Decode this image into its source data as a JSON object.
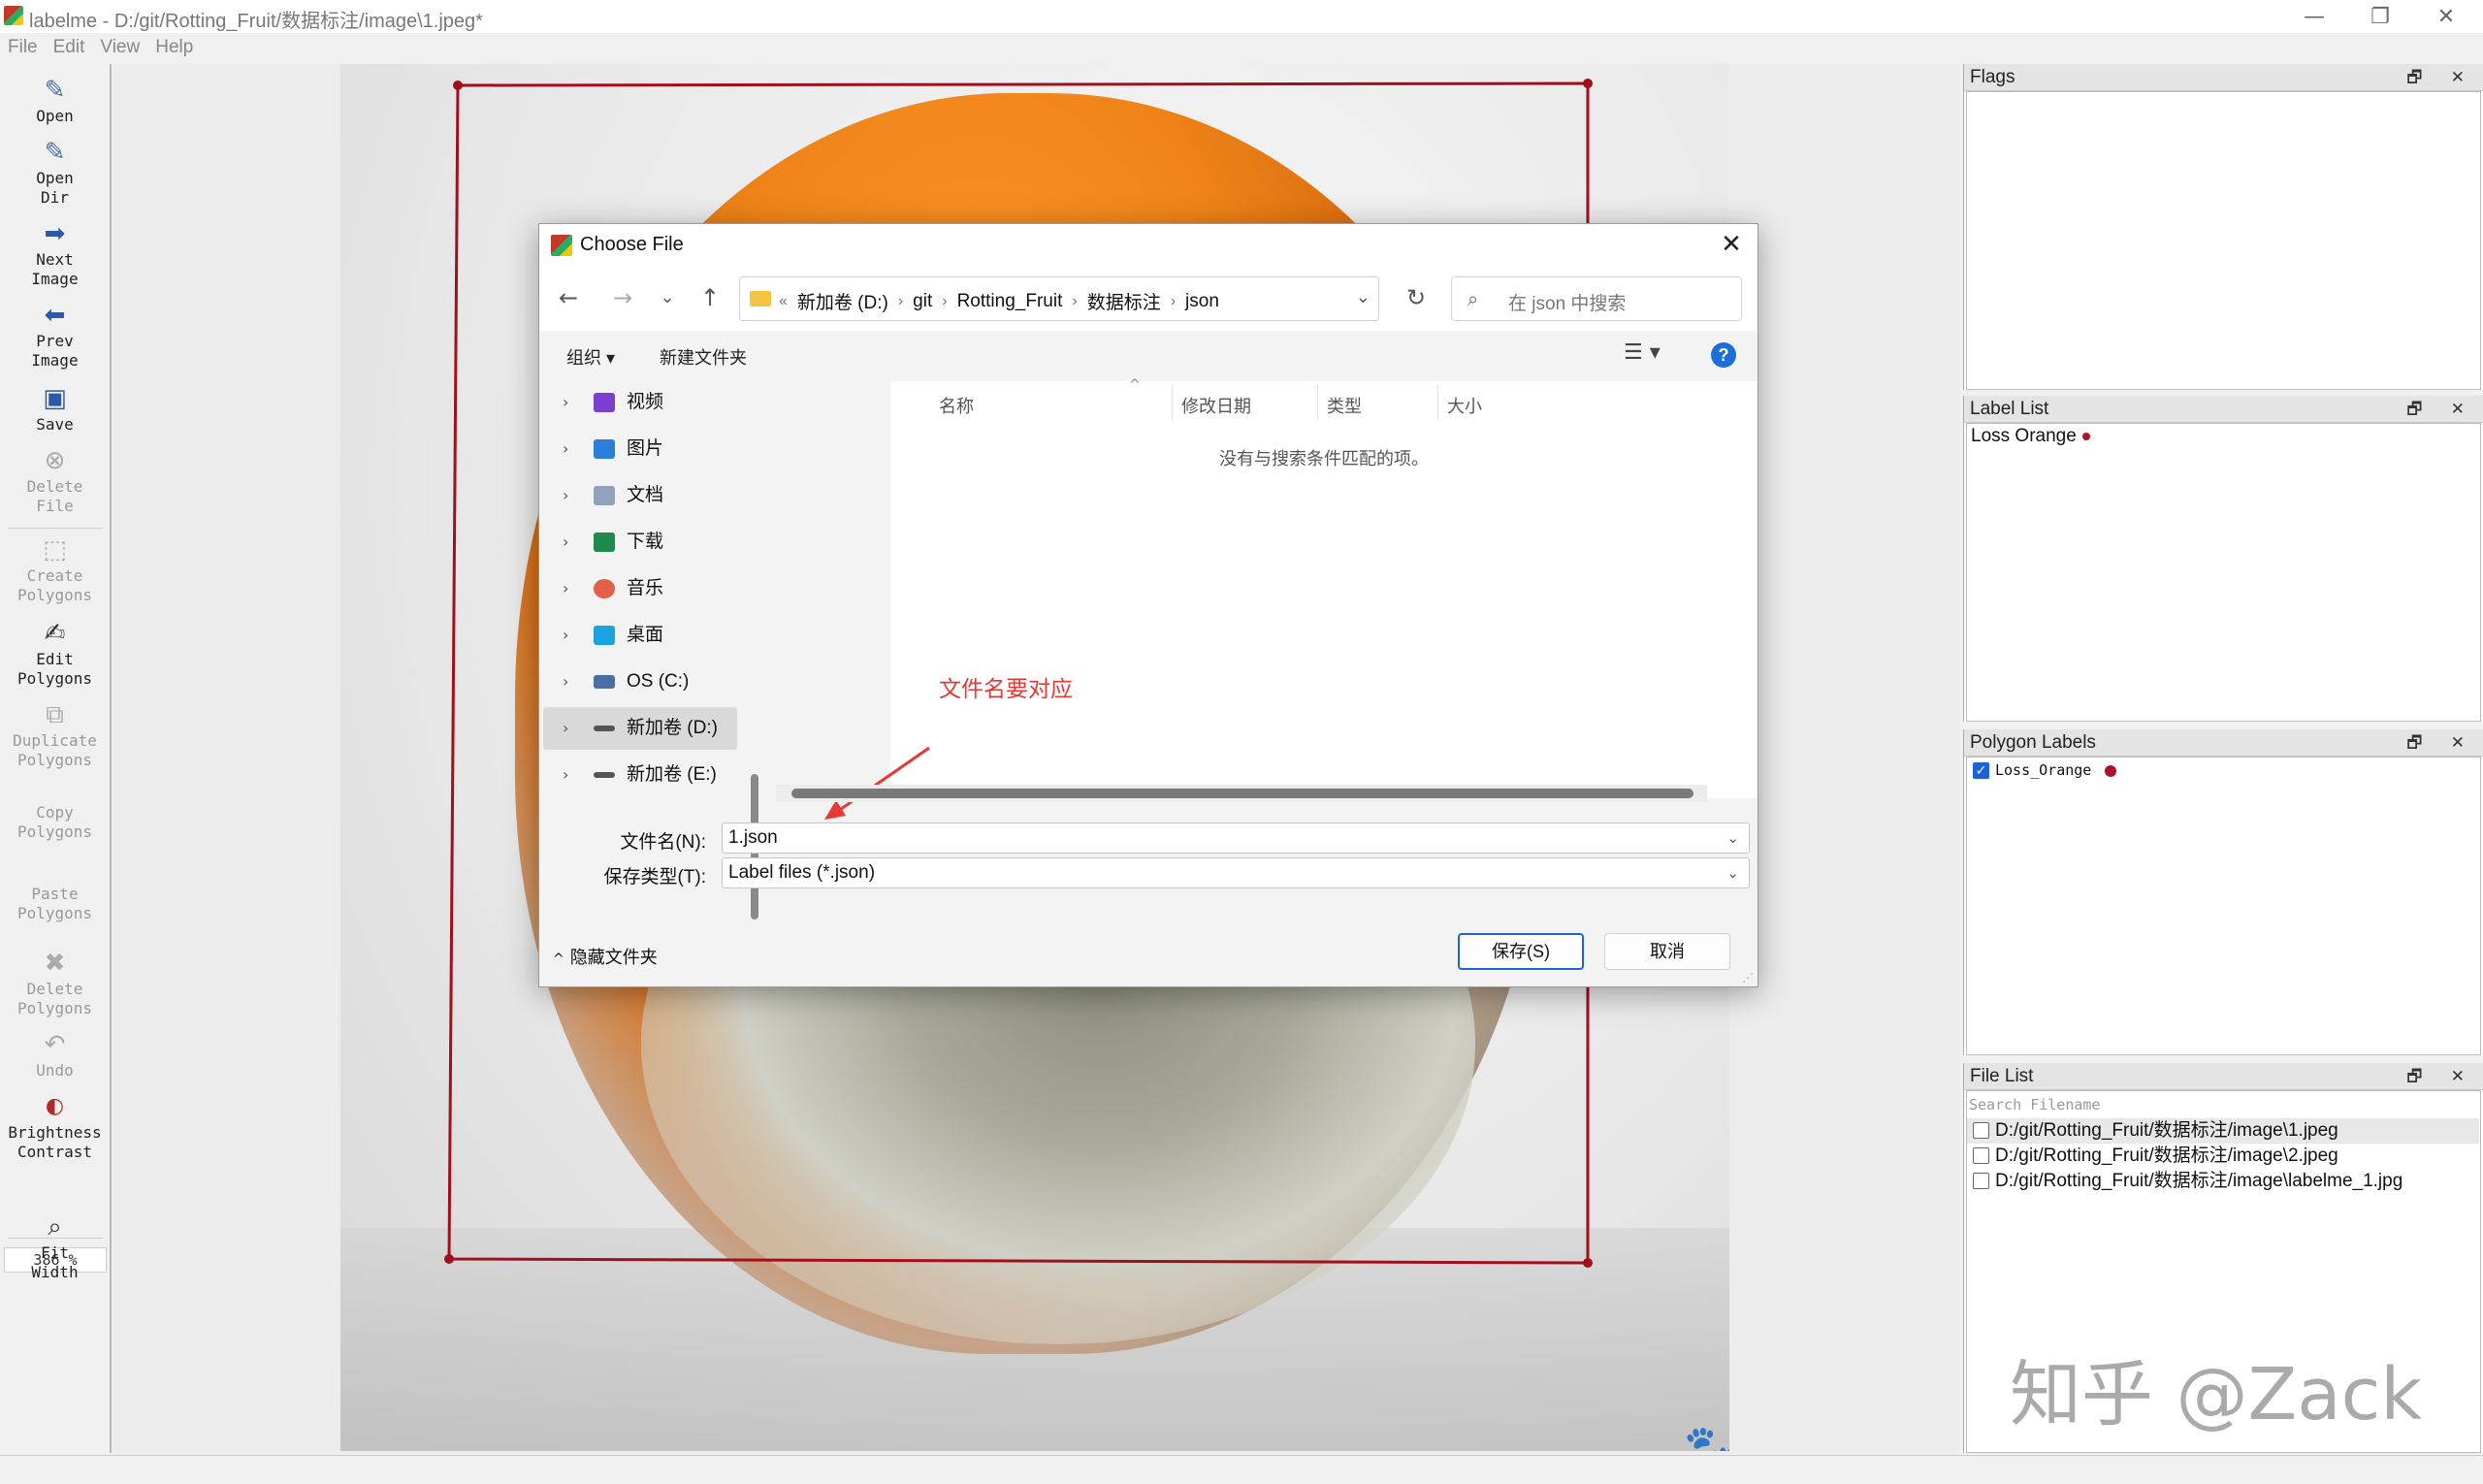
{
  "window": {
    "title": "labelme - D:/git/Rotting_Fruit/数据标注/image\\1.jpeg*",
    "minimize": "—",
    "maximize": "❐",
    "close": "✕"
  },
  "menu": [
    "File",
    "Edit",
    "View",
    "Help"
  ],
  "toolbar": {
    "open": "Open",
    "open_dir_1": "Open",
    "open_dir_2": "Dir",
    "next_1": "Next",
    "next_2": "Image",
    "prev_1": "Prev",
    "prev_2": "Image",
    "save": "Save",
    "delete_1": "Delete",
    "delete_2": "File",
    "create_1": "Create",
    "create_2": "Polygons",
    "edit_1": "Edit",
    "edit_2": "Polygons",
    "dup_1": "Duplicate",
    "dup_2": "Polygons",
    "copy_1": "Copy",
    "copy_2": "Polygons",
    "paste_1": "Paste",
    "paste_2": "Polygons",
    "delpoly_1": "Delete",
    "delpoly_2": "Polygons",
    "undo": "Undo",
    "bright_1": "Brightness",
    "bright_2": "Contrast",
    "zoom": "386 %",
    "fit_1": "Fit",
    "fit_2": "Width"
  },
  "canvas": {
    "watermark": "🐾 谚言美食厨房"
  },
  "panels": {
    "flags": {
      "title": "Flags"
    },
    "label_list": {
      "title": "Label List",
      "items": [
        "Loss Orange"
      ]
    },
    "polygon_labels": {
      "title": "Polygon Labels",
      "items": [
        "Loss_Orange"
      ]
    },
    "file_list": {
      "title": "File List",
      "search_placeholder": "Search Filename",
      "files": [
        "D:/git/Rotting_Fruit/数据标注/image\\1.jpeg",
        "D:/git/Rotting_Fruit/数据标注/image\\2.jpeg",
        "D:/git/Rotting_Fruit/数据标注/image\\labelme_1.jpg"
      ]
    },
    "controls": "🗗 ✕"
  },
  "zhihu_watermark": "知乎 @Zack",
  "dialog": {
    "title": "Choose File",
    "close": "✕",
    "nav": {
      "back": "←",
      "forward": "→",
      "recent": "⌄",
      "up": "↑",
      "refresh": "↻"
    },
    "address": {
      "prefix": "«",
      "crumbs": [
        "新加卷 (D:)",
        "git",
        "Rotting_Fruit",
        "数据标注",
        "json"
      ],
      "separator": "›",
      "dropdown": "⌄"
    },
    "search_placeholder": "在 json 中搜索",
    "search_icon": "⌕",
    "organize": "组织 ▾",
    "new_folder": "新建文件夹",
    "view_toggle": "☰ ▾",
    "help": "?",
    "sidebar": [
      {
        "label": "视频",
        "icon": "video-icon",
        "color": "#7b3fd0"
      },
      {
        "label": "图片",
        "icon": "picture-icon",
        "color": "#2b7fd8"
      },
      {
        "label": "文档",
        "icon": "document-icon",
        "color": "#8fa3bf"
      },
      {
        "label": "下载",
        "icon": "download-icon",
        "color": "#1e8a4c"
      },
      {
        "label": "音乐",
        "icon": "music-icon",
        "color": "#e0604a"
      },
      {
        "label": "桌面",
        "icon": "desktop-icon",
        "color": "#1aa3e0"
      },
      {
        "label": "OS (C:)",
        "icon": "drive-c-icon",
        "color": "#4a6fa5"
      },
      {
        "label": "新加卷 (D:)",
        "icon": "drive-icon",
        "color": "#555555"
      },
      {
        "label": "新加卷 (E:)",
        "icon": "drive-icon",
        "color": "#555555"
      }
    ],
    "sidebar_chevron": "›",
    "columns": [
      "名称",
      "修改日期",
      "类型",
      "大小"
    ],
    "sort_caret": "^",
    "empty_message": "没有与搜索条件匹配的项。",
    "annotation": "文件名要对应",
    "filename_label": "文件名(N):",
    "filename_value": "1.json",
    "filetype_label": "保存类型(T):",
    "filetype_value": "Label files (*.json)",
    "select_caret": "⌄",
    "hide_folders": "隐藏文件夹",
    "hide_caret": "^",
    "save_button": "保存(S)",
    "cancel_button": "取消",
    "annotation_color": "#e53935"
  },
  "bbox_color": "#a0101c"
}
